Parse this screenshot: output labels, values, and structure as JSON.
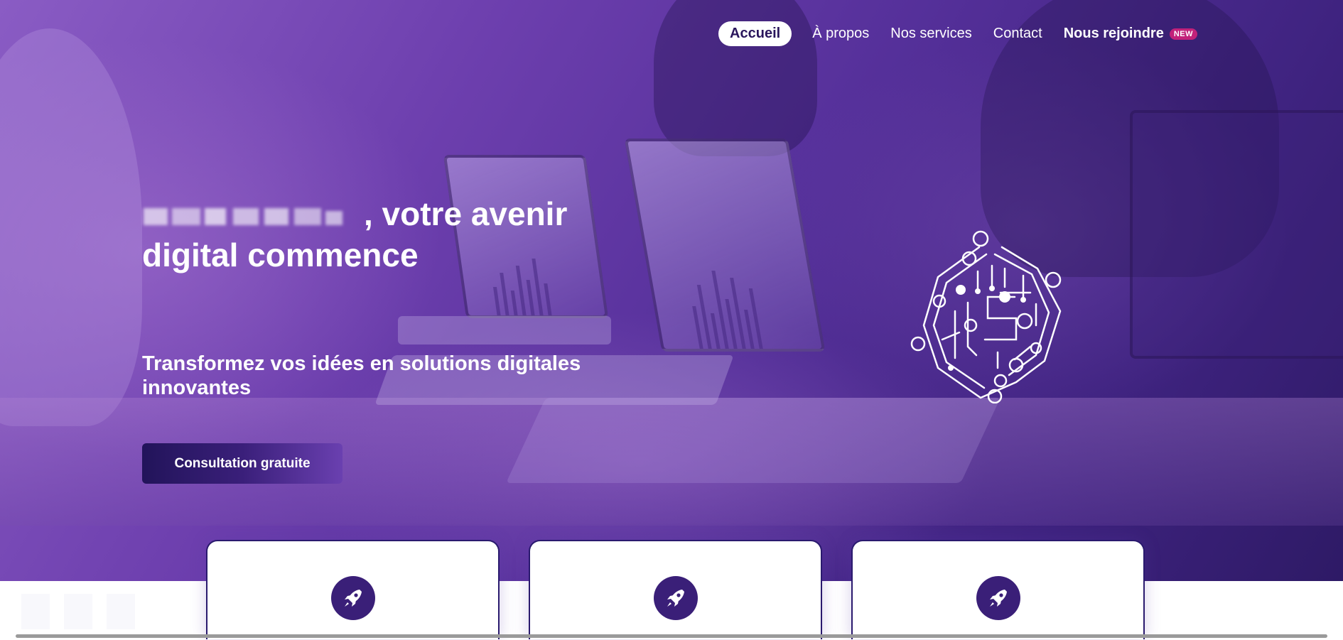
{
  "nav": {
    "items": [
      {
        "label": "Accueil",
        "active": true
      },
      {
        "label": "À propos"
      },
      {
        "label": "Nos services"
      },
      {
        "label": "Contact"
      }
    ],
    "join_label": "Nous rejoindre",
    "join_badge": "NEW"
  },
  "hero": {
    "title_prefix_blurred": "",
    "title_rest": ", votre avenir digital commence",
    "subtitle": "Transformez vos idées en solutions digitales innovantes",
    "cta_label": "Consultation gratuite",
    "logo_icon": "circuit-s-logo"
  },
  "cards": [
    {
      "icon": "rocket-icon"
    },
    {
      "icon": "rocket-icon"
    },
    {
      "icon": "rocket-icon"
    }
  ],
  "colors": {
    "brand_dark": "#2a165c",
    "brand_purple": "#6d3fae",
    "badge_pink": "#c2227a",
    "card_border": "#2a1a6e"
  }
}
